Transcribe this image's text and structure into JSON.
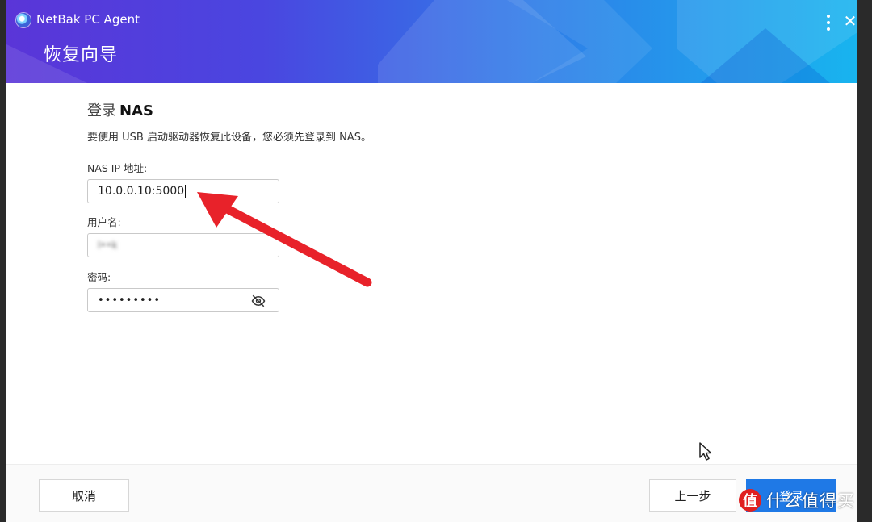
{
  "app": {
    "name": "NetBak PC Agent"
  },
  "header": {
    "title": "恢复向导",
    "menu_icon": "vertical-dots-icon",
    "close_icon": "close-icon"
  },
  "login": {
    "title_prefix": "登录",
    "title_main": "NAS",
    "description": "要使用 USB 启动驱动器恢复此设备，您必须先登录到 NAS。"
  },
  "fields": {
    "nas_ip": {
      "label": "NAS IP 地址:",
      "value": "10.0.0.10:5000"
    },
    "username": {
      "label": "用户名:",
      "value": "l••k"
    },
    "password": {
      "label": "密码:",
      "value": "•••••••••",
      "icon": "eye-slash-icon"
    }
  },
  "footer": {
    "cancel": "取消",
    "back": "上一步",
    "next": "登录"
  },
  "watermark": {
    "badge": "值",
    "text": "什么值得买"
  },
  "colors": {
    "primary": "#1f79e6",
    "annotation_arrow": "#e8222a"
  }
}
